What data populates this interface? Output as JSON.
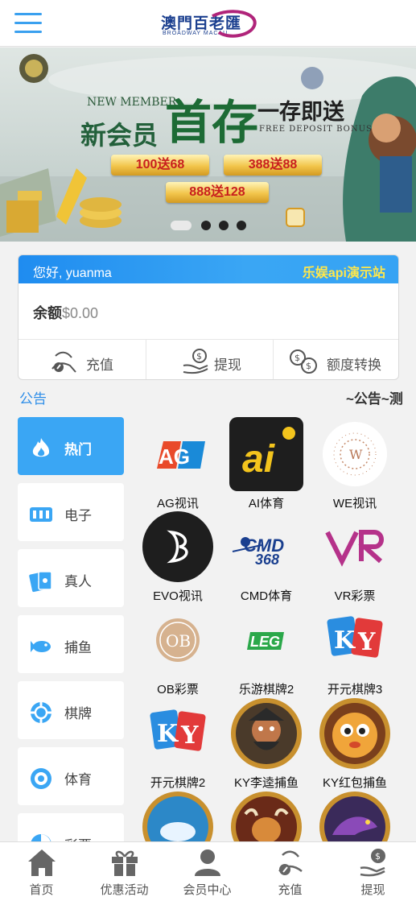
{
  "header": {
    "logo_cn": "澳門百老匯",
    "logo_en": "BROADWAY MACAU"
  },
  "banner": {
    "new_member_en": "NEW MEMBER",
    "new_member_cn": "新会员",
    "first_deposit": "首存",
    "deposit_bonus": "一存即送",
    "free_deposit_en": "FREE DEPOSIT BONUS",
    "offers": [
      "100送68",
      "388送88",
      "888送128"
    ],
    "slides_total": 4,
    "slide_active": 1
  },
  "account": {
    "greeting": "您好, yuanma",
    "site_name": "乐娱api演示站",
    "balance_label": "余额",
    "balance_value": "$0.00",
    "actions": [
      "充值",
      "提现",
      "额度转换"
    ]
  },
  "notice": {
    "label": "公告",
    "text": "~公告~测"
  },
  "categories": [
    {
      "label": "热门",
      "icon": "fire-icon",
      "active": true
    },
    {
      "label": "电子",
      "icon": "slot-icon",
      "active": false
    },
    {
      "label": "真人",
      "icon": "cards-icon",
      "active": false
    },
    {
      "label": "捕鱼",
      "icon": "fish-icon",
      "active": false
    },
    {
      "label": "棋牌",
      "icon": "chip-icon",
      "active": false
    },
    {
      "label": "体育",
      "icon": "ball-icon",
      "active": false
    },
    {
      "label": "彩票",
      "icon": "lottery-icon",
      "active": false
    }
  ],
  "games": [
    {
      "label": "AG视讯",
      "icon": "ag-logo-icon"
    },
    {
      "label": "AI体育",
      "icon": "ai-logo-icon"
    },
    {
      "label": "WE视讯",
      "icon": "we-logo-icon"
    },
    {
      "label": "EVO视讯",
      "icon": "evo-logo-icon"
    },
    {
      "label": "CMD体育",
      "icon": "cmd-logo-icon"
    },
    {
      "label": "VR彩票",
      "icon": "vr-logo-icon"
    },
    {
      "label": "OB彩票",
      "icon": "ob-logo-icon"
    },
    {
      "label": "乐游棋牌2",
      "icon": "leg-logo-icon"
    },
    {
      "label": "开元棋牌3",
      "icon": "ky-logo-icon"
    },
    {
      "label": "开元棋牌2",
      "icon": "ky-logo-icon"
    },
    {
      "label": "KY李逵捕鱼",
      "icon": "warrior-icon"
    },
    {
      "label": "KY红包捕鱼",
      "icon": "pufferfish-icon"
    }
  ],
  "games_partial": [
    "ocean-game-icon",
    "bull-game-icon",
    "dino-game-icon"
  ],
  "tabbar": [
    {
      "label": "首页",
      "icon": "home-icon"
    },
    {
      "label": "优惠活动",
      "icon": "gift-icon"
    },
    {
      "label": "会员中心",
      "icon": "user-icon"
    },
    {
      "label": "充值",
      "icon": "deposit-icon"
    },
    {
      "label": "提现",
      "icon": "withdraw-icon"
    }
  ],
  "colors": {
    "accent": "#3aa6f4",
    "site_name": "#ffe74a",
    "notice_label": "#2f8ee8"
  }
}
